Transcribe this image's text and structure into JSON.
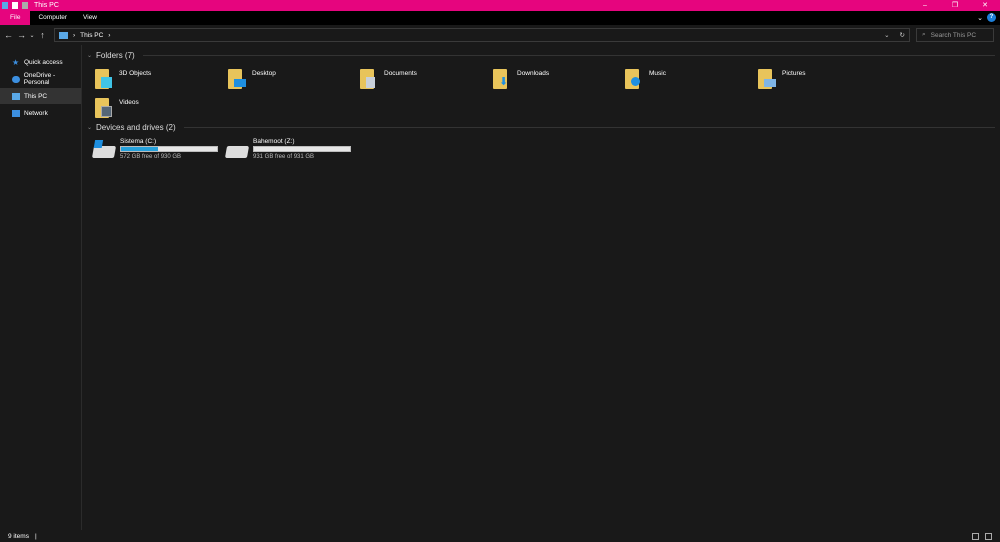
{
  "window": {
    "title": "This PC",
    "minimize": "–",
    "maximize": "❐",
    "close": "✕"
  },
  "ribbon": {
    "tabs": [
      "File",
      "Computer",
      "View"
    ],
    "expand": "⌄",
    "help": "?"
  },
  "nav": {
    "back": "←",
    "forward": "→",
    "recent": "⌄",
    "up": "↑",
    "path": "This PC",
    "sep": "›",
    "dropdown": "⌄",
    "refresh": "↻",
    "search_placeholder": "Search This PC"
  },
  "sidebar": {
    "items": [
      {
        "label": "Quick access",
        "color": "#3c8fe0"
      },
      {
        "label": "OneDrive - Personal",
        "color": "#3c8fe0"
      },
      {
        "label": "This PC",
        "color": "#5aa8e6"
      },
      {
        "label": "Network",
        "color": "#3c8fe0"
      }
    ]
  },
  "folders": {
    "header": "Folders (7)",
    "items": [
      {
        "label": "3D Objects",
        "color": "#3fc4e6"
      },
      {
        "label": "Desktop",
        "color": "#1e8fe0"
      },
      {
        "label": "Documents",
        "color": "#c8d0da"
      },
      {
        "label": "Downloads",
        "color": "#1e8fe0"
      },
      {
        "label": "Music",
        "color": "#1e8fe0"
      },
      {
        "label": "Pictures",
        "color": "#7fb5e6"
      },
      {
        "label": "Videos",
        "color": "#556677"
      }
    ]
  },
  "drives": {
    "header": "Devices and drives (2)",
    "items": [
      {
        "label": "Sistema (C:)",
        "free": "572 GB free of 930 GB",
        "used_percent": 38.5
      },
      {
        "label": "Bahemoot (Z:)",
        "free": "931 GB free of 931 GB",
        "used_percent": 0
      }
    ]
  },
  "status": {
    "items": "9 items",
    "sep": "|"
  }
}
